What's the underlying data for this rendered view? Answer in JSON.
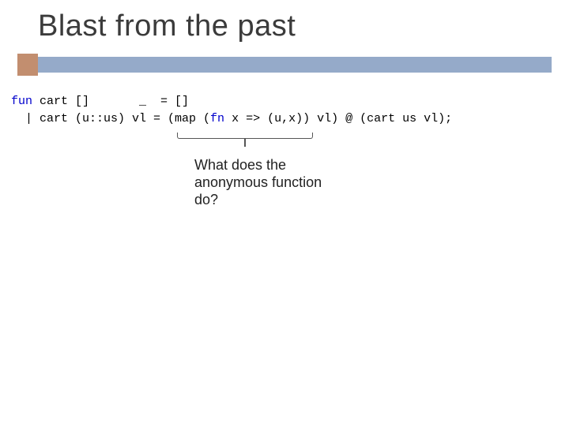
{
  "title": "Blast from the past",
  "code": {
    "kw_fun": "fun",
    "line1_rest": " cart []       _  = []",
    "line2_pipe": "  | cart (u::us) vl = (map (",
    "kw_fn": "fn",
    "line2_mid": " x => (u,x)) vl) @ (cart us vl);"
  },
  "annotation": {
    "l1": "What does the",
    "l2": "anonymous function",
    "l3": "do?"
  }
}
